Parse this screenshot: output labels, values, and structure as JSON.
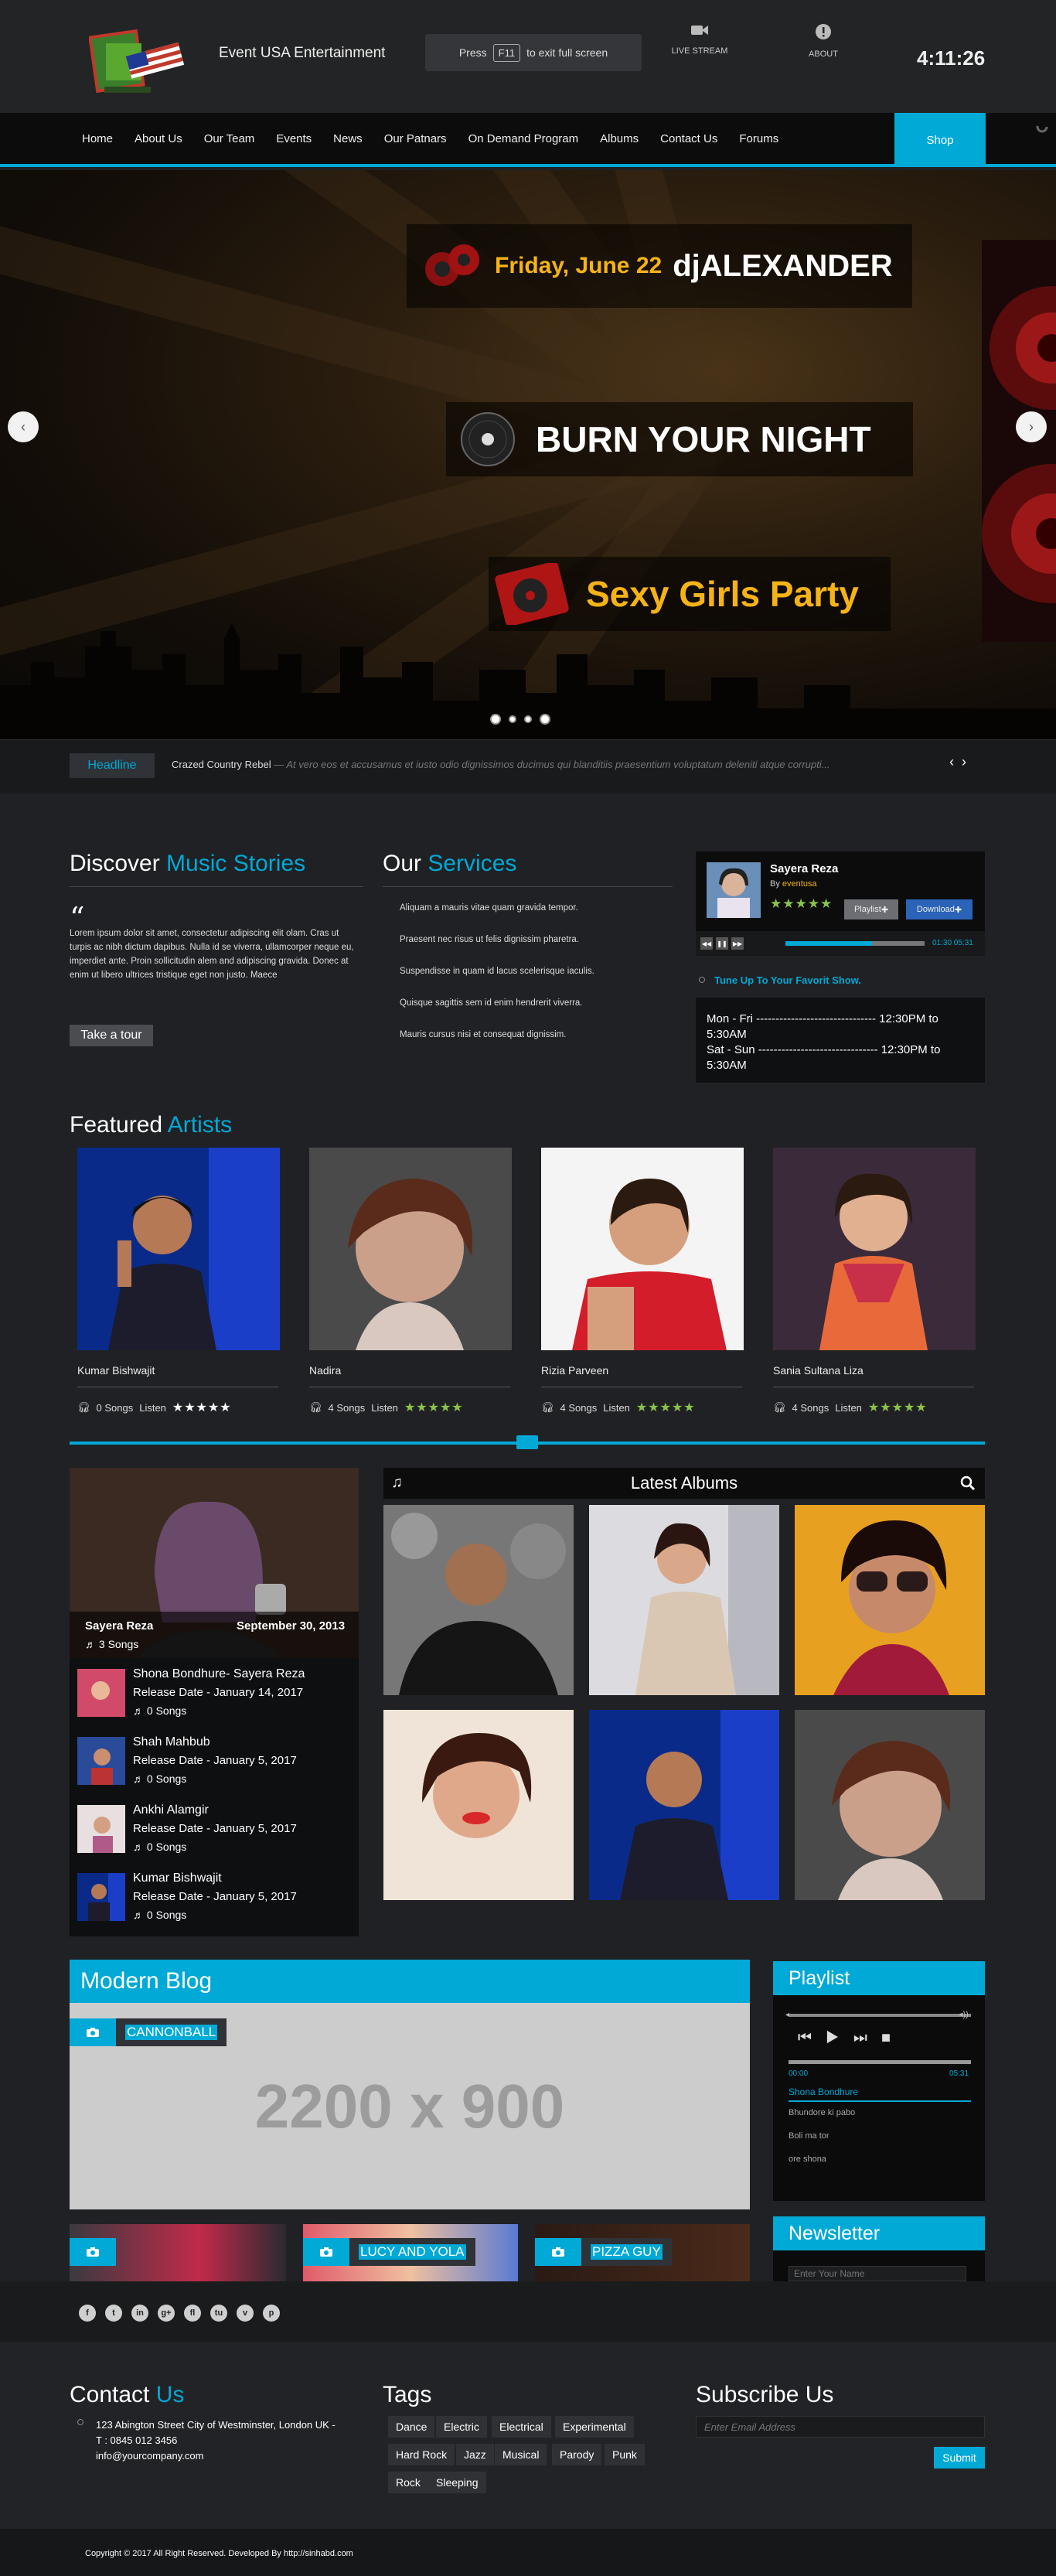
{
  "header": {
    "brand": "Event USA Entertainment",
    "fs_press": "Press",
    "fs_key": "F11",
    "fs_rest": "to exit full screen",
    "live_stream": "LIVE STREAM",
    "about": "ABOUT",
    "clock": "4:11:26"
  },
  "nav": {
    "items": [
      "Home",
      "About Us",
      "Our Team",
      "Events",
      "News",
      "Our Patnars",
      "On Demand Program",
      "Albums",
      "Contact Us",
      "Forums"
    ],
    "shop": "Shop"
  },
  "hero": {
    "date": "Friday, June 22",
    "dj": "djALEXANDER",
    "burn": "BURN YOUR NIGHT",
    "party": "Sexy Girls Party"
  },
  "ticker": {
    "label": "Headline",
    "title": "Crazed Country Rebel",
    "dash": " — ",
    "text": "At vero eos et accusamus et iusto odio dignissimos ducimus qui blanditiis praesentium voluptatum deleniti atque corrupti..."
  },
  "discover": {
    "h1": "Discover",
    "h2": "Music Stories",
    "para": "Lorem ipsum dolor sit amet, consectetur adipiscing elit olam. Cras ut turpis ac nibh dictum dapibus. Nulla id se viverra, ullamcorper neque eu, imperdiet ante. Proin sollicitudin alem and adipiscing gravida. Donec at enim ut libero ultrices tristique eget non justo. Maece",
    "tour": "Take a tour"
  },
  "services": {
    "h1": "Our",
    "h2": "Services",
    "items": [
      "Aliquam a mauris vitae quam gravida tempor.",
      "Praesent nec risus ut felis dignissim pharetra.",
      "Suspendisse in quam id lacus scelerisque iaculis.",
      "Quisque sagittis sem id enim hendrerit viverra.",
      "Mauris cursus nisi et consequat dignissim."
    ]
  },
  "player": {
    "name": "Sayera Reza",
    "by": "By",
    "user": "eventusa",
    "playlist": "Playlist",
    "download": "Download",
    "time": "01:30 05:31",
    "tune": "Tune Up To Your Favorit Show.",
    "sched1": "Mon - Fri ------------------------------- 12:30PM to 5:30AM",
    "sched2": "Sat - Sun ------------------------------- 12:30PM to 5:30AM",
    "progress": 0.62
  },
  "artists": {
    "h1": "Featured",
    "h2": "Artists",
    "listen": "Listen",
    "items": [
      {
        "name": "Kumar Bishwajit",
        "songs": "0 Songs",
        "rating": 5,
        "color": "#fff"
      },
      {
        "name": "Nadira",
        "songs": "4 Songs",
        "rating": 5,
        "color": "#8bc34a"
      },
      {
        "name": "Rizia Parveen",
        "songs": "4 Songs",
        "rating": 5,
        "color": "#8bc34a"
      },
      {
        "name": "Sania Sultana Liza",
        "songs": "4 Songs",
        "rating": 5,
        "color": "#8bc34a"
      }
    ]
  },
  "featured": {
    "name": "Sayera Reza",
    "date": "September 30, 2013",
    "songs": "3 Songs",
    "list": [
      {
        "title": "Shona Bondhure- Sayera Reza",
        "date": "Release Date - January 14, 2017",
        "songs": "0 Songs"
      },
      {
        "title": "Shah Mahbub",
        "date": "Release Date - January 5, 2017",
        "songs": "0 Songs"
      },
      {
        "title": "Ankhi Alamgir",
        "date": "Release Date - January 5, 2017",
        "songs": "0 Songs"
      },
      {
        "title": "Kumar Bishwajit",
        "date": "Release Date - January 5, 2017",
        "songs": "0 Songs"
      }
    ]
  },
  "latest": {
    "title": "Latest Albums"
  },
  "blog": {
    "title": "Modern Blog",
    "tag": "CANNONBALL",
    "placeholder": "2200 x 900",
    "t2": "LUCY AND YOLA",
    "t3": "PIZZA GUY"
  },
  "playlist": {
    "title": "Playlist",
    "t0": "00:00",
    "t1": "05:31",
    "tracks": [
      "Shona Bondhure",
      "Bhundore ki pabo",
      "Boli ma tor",
      "ore shona"
    ]
  },
  "newsletter": {
    "title": "Newsletter",
    "placeholder": "Enter Your Name"
  },
  "social": [
    "f",
    "t",
    "in",
    "g+",
    "fl",
    "tu",
    "v",
    "p"
  ],
  "contact": {
    "h1": "Contact",
    "h2": "Us",
    "addr": "123 Abington Street City of Westminster, London UK -",
    "tel": "T : 0845 012 3456",
    "mail": "info@yourcompany.com"
  },
  "tags": {
    "title": "Tags",
    "items": [
      "Dance",
      "Electric",
      "Electrical",
      "Experimental",
      "Hard Rock",
      "Jazz",
      "Musical",
      "Parody",
      "Punk",
      "Rock",
      "Sleeping"
    ]
  },
  "subscribe": {
    "title": "Subscribe Us",
    "placeholder": "Enter Email Address",
    "btn": "Submit"
  },
  "copyright": "Copyright © 2017 All Right Reserved. Developed By http://sinhabd.com"
}
